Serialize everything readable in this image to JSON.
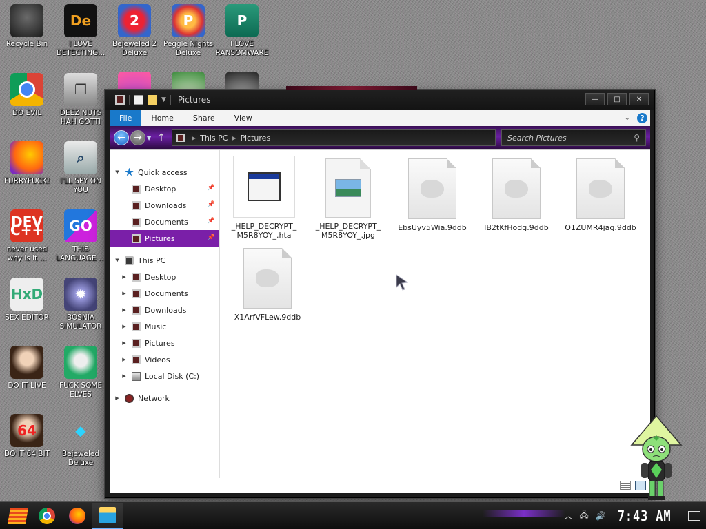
{
  "desktop": {
    "icons": [
      {
        "label": "Recycle Bin",
        "glyph": "",
        "icon": "recycle-bin-icon"
      },
      {
        "label": "I LOVE\nDETECTING...",
        "glyph": "De",
        "icon": "detect-it-easy-icon"
      },
      {
        "label": "Bejeweled 2\nDeluxe",
        "glyph": "2",
        "icon": "bejeweled-2-icon"
      },
      {
        "label": "Peggle Nights\nDeluxe",
        "glyph": "P",
        "icon": "peggle-icon"
      },
      {
        "label": "I LOVE\nRANSOMWARE",
        "glyph": "P",
        "icon": "publisher-icon"
      },
      {
        "label": "DO EVIL",
        "glyph": "",
        "icon": "chrome-icon"
      },
      {
        "label": "DEEZ NUTS\nHAH GOTTI",
        "glyph": "❐",
        "icon": "copy-icon"
      },
      {
        "label": "FURRYFUCK!",
        "glyph": "",
        "icon": "firefox-icon"
      },
      {
        "label": "I'LL SPY ON\nYOU",
        "glyph": "⌕",
        "icon": "spy-icon"
      },
      {
        "label": "never used\nwhy is it ...",
        "glyph": "DEV\nC++",
        "icon": "dev-cpp-icon"
      },
      {
        "label": "THIS\nLANGUAGE ...",
        "glyph": "GO",
        "icon": "goland-icon"
      },
      {
        "label": "SEX EDITOR",
        "glyph": "HxD",
        "icon": "hxd-icon"
      },
      {
        "label": "BOSNIA\nSIMULATOR",
        "glyph": "✹",
        "icon": "mine-icon"
      },
      {
        "label": "DO IT LIVE",
        "glyph": "",
        "icon": "portrait-icon"
      },
      {
        "label": "FUCK SOME\nELVES",
        "glyph": "",
        "icon": "elves-icon"
      },
      {
        "label": "DO IT 64 BIT",
        "glyph": "64",
        "icon": "portrait-64-icon"
      },
      {
        "label": "Bejeweled\nDeluxe",
        "glyph": "◆",
        "icon": "bejeweled-icon"
      }
    ]
  },
  "window": {
    "title": "Pictures",
    "controls": {
      "minimize": "—",
      "maximize": "□",
      "close": "✕"
    },
    "ribbon": {
      "tabs": [
        "File",
        "Home",
        "Share",
        "View"
      ],
      "expand": "⌄",
      "help": "?"
    },
    "address": {
      "crumbs": [
        "This PC",
        "Pictures"
      ],
      "search_placeholder": "Search Pictures"
    },
    "nav": {
      "quick_access": "Quick access",
      "quick_items": [
        "Desktop",
        "Downloads",
        "Documents",
        "Pictures"
      ],
      "this_pc": "This PC",
      "pc_items": [
        "Desktop",
        "Documents",
        "Downloads",
        "Music",
        "Pictures",
        "Videos",
        "Local Disk (C:)"
      ],
      "network": "Network"
    },
    "files": [
      {
        "name": "_HELP_DECRYPT_\nM5R8YOY_.hta",
        "type": "hta"
      },
      {
        "name": "_HELP_DECRYPT_\nM5R8YOY_.jpg",
        "type": "jpg"
      },
      {
        "name": "EbsUyv5Wia.9ddb",
        "type": "blank"
      },
      {
        "name": "lB2tKfHodg.9ddb",
        "type": "blank"
      },
      {
        "name": "O1ZUMR4jag.9ddb",
        "type": "blank"
      },
      {
        "name": "X1ArfVFLew.9ddb",
        "type": "blank"
      }
    ]
  },
  "taskbar": {
    "clock": "7:43 AM"
  },
  "colors": {
    "accent_purple": "#7a1fa8",
    "file_tab_blue": "#1979ca",
    "window_frame": "#1c1c1c"
  }
}
